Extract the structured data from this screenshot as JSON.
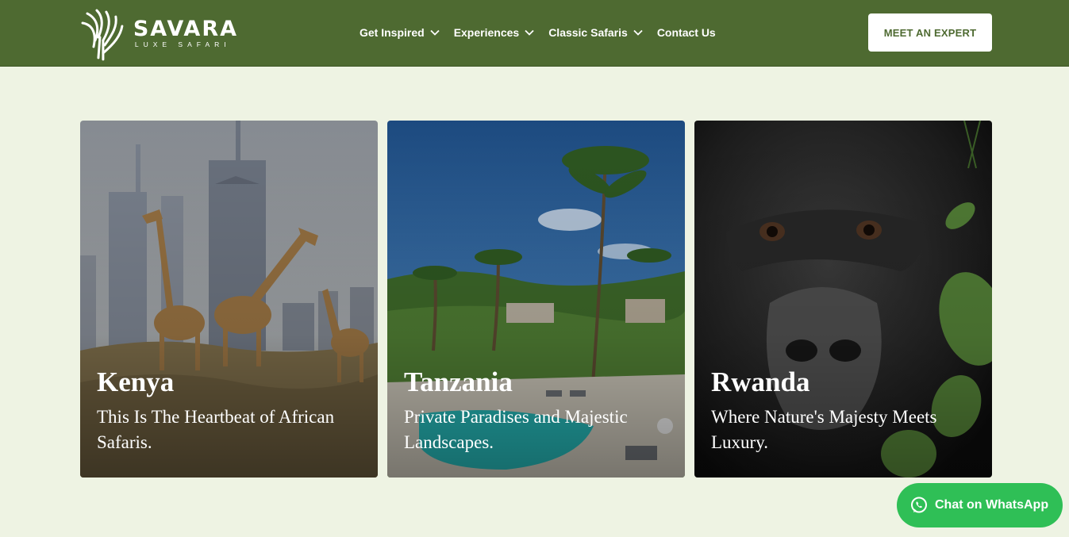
{
  "brand": {
    "name": "SAVARA",
    "tagline": "LUXE SAFARI"
  },
  "nav": {
    "items": [
      {
        "label": "Get Inspired",
        "has_dropdown": true
      },
      {
        "label": "Experiences",
        "has_dropdown": true
      },
      {
        "label": "Classic Safaris",
        "has_dropdown": true
      },
      {
        "label": "Contact Us",
        "has_dropdown": false
      }
    ],
    "cta_label": "MEET AN EXPERT"
  },
  "destinations": [
    {
      "title": "Kenya",
      "description": "This Is The Heartbeat of African Safaris."
    },
    {
      "title": "Tanzania",
      "description": "Private Paradises and Majestic Landscapes."
    },
    {
      "title": "Rwanda",
      "description": "Where Nature's Majesty Meets Luxury."
    }
  ],
  "whatsapp": {
    "label": "Chat on WhatsApp",
    "icon": "whatsapp-icon"
  },
  "colors": {
    "header": "#4e6a31",
    "page_bg": "#eef3e3",
    "whatsapp": "#2fbf56",
    "cta_text": "#4e6a31"
  }
}
